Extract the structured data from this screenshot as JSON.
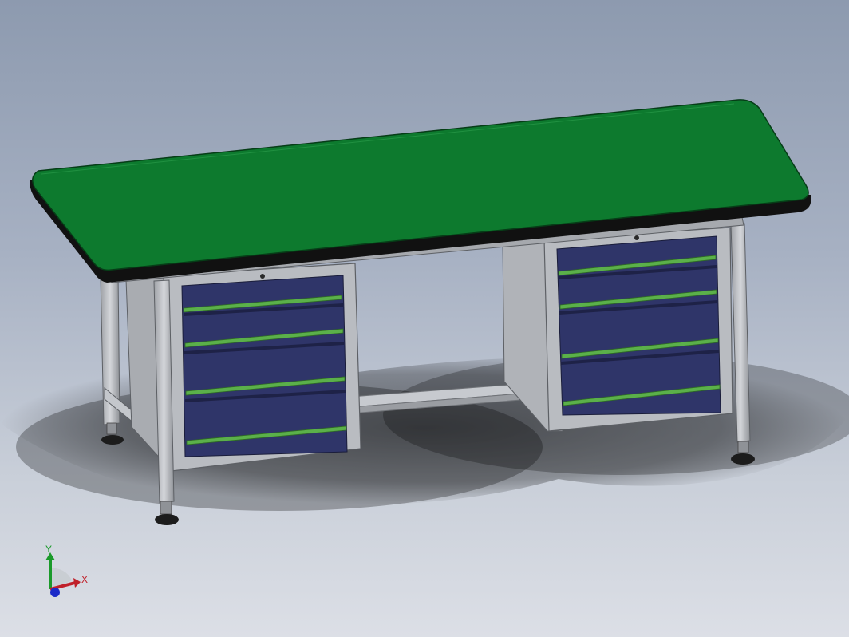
{
  "viewport": {
    "background_top": "#8d9aaf",
    "background_bottom": "#dcdfe6"
  },
  "model": {
    "name": "workbench",
    "colors": {
      "top": "#0d7a2e",
      "top_edge": "#111111",
      "frame": "#b9bcc1",
      "frame_dark": "#8d9095",
      "cabinet": "#aeb1b6",
      "drawer": "#2f3569",
      "drawer_handle": "#5bb04a",
      "foot": "#1c1c1c"
    },
    "left_cabinet_drawers": 4,
    "right_cabinet_drawers": 4
  },
  "triad": {
    "x_label": "X",
    "y_label": "Y",
    "x_color": "#c0202a",
    "y_color": "#1a9a2a",
    "z_color": "#1b2ac8"
  }
}
